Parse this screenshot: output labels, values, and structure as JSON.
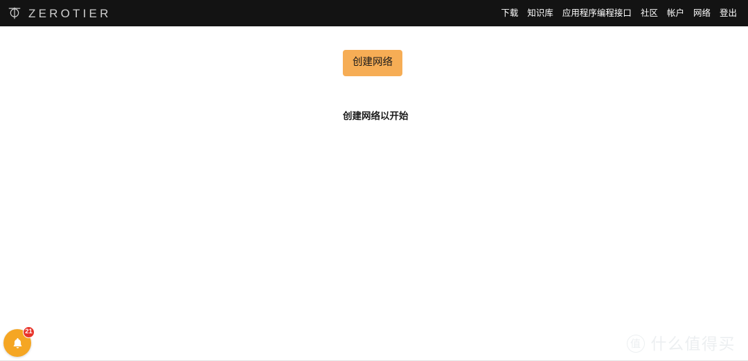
{
  "header": {
    "logo_icon": "zerotier-phi-icon",
    "brand": "ZEROTIER",
    "nav": [
      {
        "label": "下载",
        "name": "nav-download"
      },
      {
        "label": "知识库",
        "name": "nav-knowledge-base"
      },
      {
        "label": "应用程序编程接口",
        "name": "nav-api"
      },
      {
        "label": "社区",
        "name": "nav-community"
      },
      {
        "label": "帐户",
        "name": "nav-account"
      },
      {
        "label": "网络",
        "name": "nav-networks"
      },
      {
        "label": "登出",
        "name": "nav-logout"
      }
    ]
  },
  "main": {
    "create_button_label": "创建网络",
    "empty_state_heading": "创建网络以开始"
  },
  "notifications": {
    "icon": "bell-icon",
    "count": "21"
  },
  "watermark": {
    "badge_text": "值",
    "text": "什么值得买"
  },
  "colors": {
    "header_bg": "#131313",
    "accent_orange": "#f6ad55",
    "bell_orange": "#f5a623",
    "badge_red": "#e8342a",
    "page_bg": "#ffffff"
  }
}
